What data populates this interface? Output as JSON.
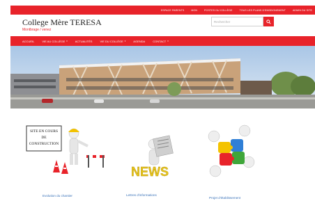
{
  "topbar": {
    "links": [
      "ESPACE PARENTS",
      "MON",
      "POSTES DU COLLÈGE",
      "TOUS LES PLANS D'ENSEIGNEMENT",
      "ADMIN DU SITE"
    ]
  },
  "header": {
    "title": "College Mère TERESA",
    "tagline": "Montbrage / venez",
    "search_placeholder": "Rechercher"
  },
  "nav": {
    "items": [
      {
        "label": "ACCUEIL",
        "dropdown": false
      },
      {
        "label": "VIE AU COLLÈGE",
        "dropdown": true
      },
      {
        "label": "ACTUALITÉS",
        "dropdown": false
      },
      {
        "label": "VIE DU COLLÈGE",
        "dropdown": true
      },
      {
        "label": "AGENDA",
        "dropdown": false
      },
      {
        "label": "CONTACT",
        "dropdown": true
      }
    ]
  },
  "features": [
    {
      "label": "Evolution du chantier",
      "image_text": [
        "SITE EN COURS",
        "DE",
        "CONSTRUCTION"
      ]
    },
    {
      "label": "Lettres d'informations",
      "image_text": [
        "NEWS"
      ]
    },
    {
      "label": "Projet d'établissement",
      "image_text": []
    }
  ],
  "colors": {
    "accent": "#e8232a",
    "link": "#3b73b9"
  }
}
